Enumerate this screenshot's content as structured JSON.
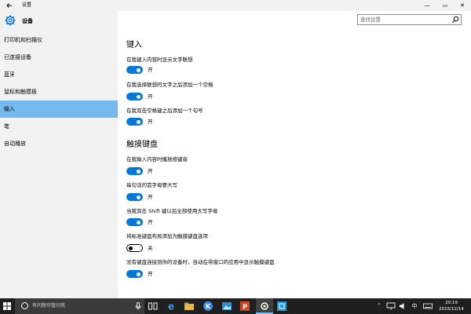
{
  "window": {
    "title": "设置",
    "back_icon": "back-arrow-icon",
    "minimize_glyph": "—",
    "maximize_glyph": "▭",
    "close_glyph": "✕"
  },
  "sidebar": {
    "header_title": "设备",
    "header_icon": "gear-icon",
    "items": [
      {
        "label": "打印机和扫描仪",
        "active": false
      },
      {
        "label": "已连接设备",
        "active": false
      },
      {
        "label": "蓝牙",
        "active": false
      },
      {
        "label": "鼠标和触摸板",
        "active": false
      },
      {
        "label": "输入",
        "active": true
      },
      {
        "label": "笔",
        "active": false
      },
      {
        "label": "自动播放",
        "active": false
      }
    ]
  },
  "search": {
    "placeholder": "查找设置",
    "icon": "search-icon"
  },
  "main": {
    "sections": [
      {
        "title": "键入",
        "options": [
          {
            "label": "在我键入内容时显示文字联想",
            "state": "开",
            "on": true
          },
          {
            "label": "在我选择联想的文字之后添加一个空格",
            "state": "开",
            "on": true
          },
          {
            "label": "在我双击空格键之后添加一个句号",
            "state": "开",
            "on": true
          }
        ]
      },
      {
        "title": "触摸键盘",
        "options": [
          {
            "label": "在我输入内容时播放按键音",
            "state": "开",
            "on": true
          },
          {
            "label": "每句话的首字母要大写",
            "state": "开",
            "on": true
          },
          {
            "label": "当我双击 Shift 键以后全部使用大写字母",
            "state": "开",
            "on": true
          },
          {
            "label": "将标准键盘布局添加为触摸键盘选项",
            "state": "关",
            "on": false
          },
          {
            "label": "没有键盘连接到你的设备时，自动在带窗口的应用中显示触摸键盘",
            "state": "开",
            "on": true
          }
        ]
      }
    ]
  },
  "taskbar": {
    "search_placeholder": "有问题尽管问我",
    "icons": [
      "windows-start-icon",
      "cortana-icon",
      "microphone-icon",
      "task-view-icon",
      "edge-icon",
      "file-explorer-icon",
      "k-app-icon",
      "photos-icon",
      "powerpoint-icon",
      "settings-icon",
      "app-icon"
    ],
    "clock_time": "20:19",
    "clock_date": "2015/12/14",
    "accent_color": "#0078d7",
    "selected_color": "#76b9ed"
  }
}
